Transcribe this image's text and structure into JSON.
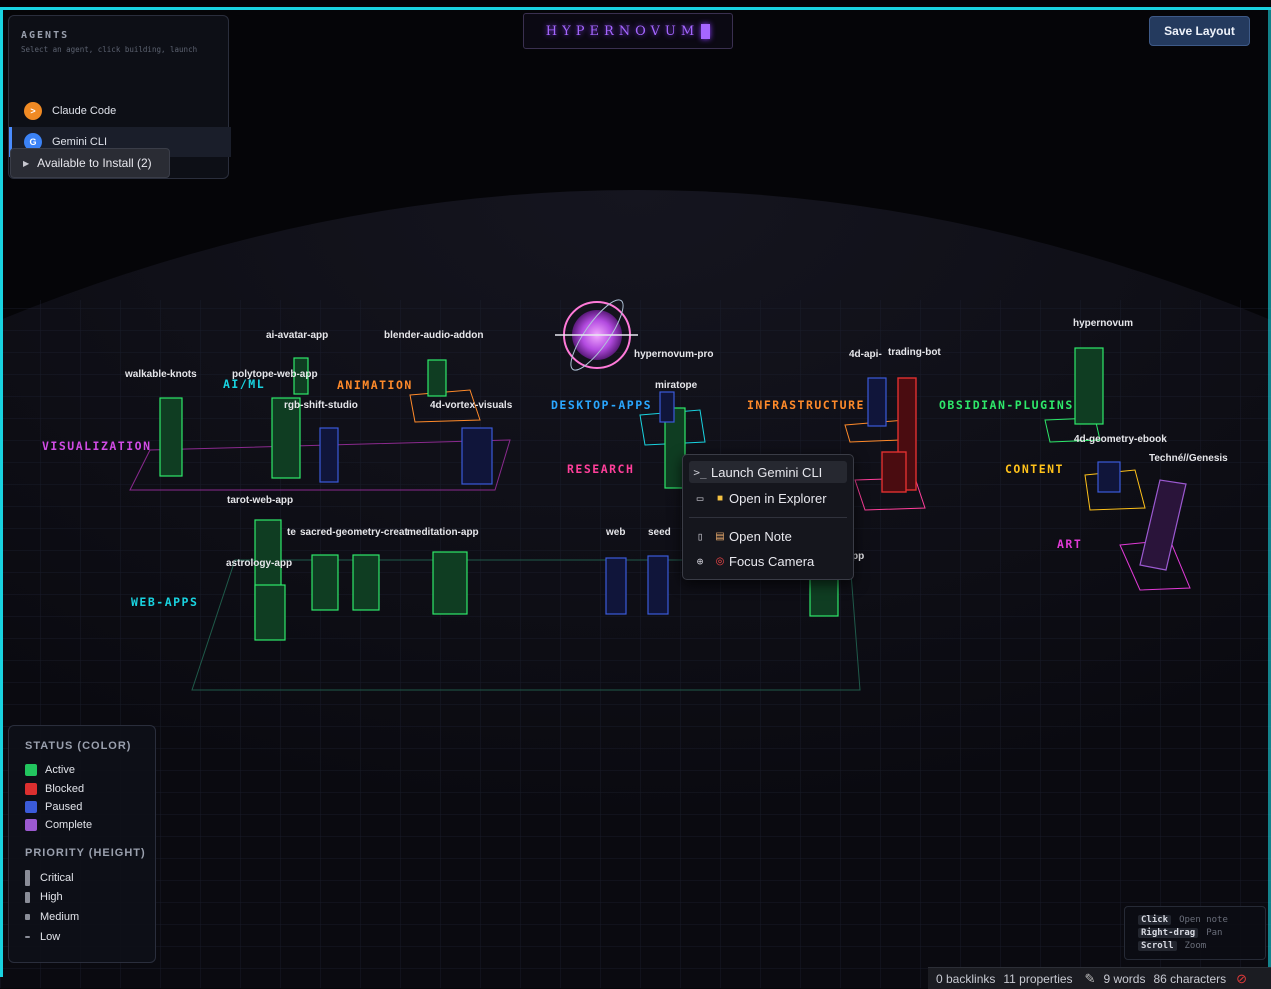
{
  "app": {
    "title": "HYPERNOVUM",
    "save_label": "Save Layout"
  },
  "agents": {
    "title": "AGENTS",
    "subtitle": "Select an agent, click building, launch",
    "items": [
      {
        "label": "Claude Code",
        "icon": ">",
        "color": "#f08a24"
      },
      {
        "label": "Gemini CLI",
        "icon": "G",
        "color": "#3b82f6",
        "selected": true
      }
    ],
    "install_label": "Available to Install (2)"
  },
  "districts": [
    {
      "label": "VISUALIZATION",
      "color": "#d14ce6"
    },
    {
      "label": "AI/ML",
      "color": "#19d3e0"
    },
    {
      "label": "ANIMATION",
      "color": "#ff8a2a"
    },
    {
      "label": "DESKTOP-APPS",
      "color": "#2aa7ff"
    },
    {
      "label": "INFRASTRUCTURE",
      "color": "#ff8a2a"
    },
    {
      "label": "OBSIDIAN-PLUGINS",
      "color": "#2ee86a"
    },
    {
      "label": "RESEARCH",
      "color": "#ff3f9a"
    },
    {
      "label": "CONTENT",
      "color": "#ffc21a"
    },
    {
      "label": "ART",
      "color": "#e03ad6"
    },
    {
      "label": "WEB-APPS",
      "color": "#19d3e0"
    }
  ],
  "projects": [
    "ai-avatar-app",
    "blender-audio-addon",
    "walkable-knots",
    "polytope-web-app",
    "rgb-shift-studio",
    "4d-vortex-visuals",
    "hypernovum-pro",
    "miratope",
    "4d-api-",
    "trading-bot",
    "hypernovum",
    "4d-geometry-ebook",
    "Techné//Genesis",
    "tarot-web-app",
    "te",
    "sacred-geometry-creat",
    "meditation-app",
    "astrology-app",
    "web",
    "seed",
    "pp"
  ],
  "context_menu": {
    "launch": "Launch Gemini CLI",
    "open_explorer": "Open in Explorer",
    "open_note": "Open Note",
    "focus_camera": "Focus Camera"
  },
  "legend": {
    "status_title": "STATUS (COLOR)",
    "status": [
      {
        "label": "Active",
        "color": "#22c55e"
      },
      {
        "label": "Blocked",
        "color": "#dc2f2f"
      },
      {
        "label": "Paused",
        "color": "#3b5bd9"
      },
      {
        "label": "Complete",
        "color": "#9b59d0"
      }
    ],
    "priority_title": "PRIORITY (HEIGHT)",
    "priority": [
      "Critical",
      "High",
      "Medium",
      "Low"
    ]
  },
  "help": [
    {
      "key": "Click",
      "action": "Open note"
    },
    {
      "key": "Right-drag",
      "action": "Pan"
    },
    {
      "key": "Scroll",
      "action": "Zoom"
    }
  ],
  "statusbar": {
    "backlinks": "0 backlinks",
    "properties": "11 properties",
    "words": "9 words",
    "characters": "86 characters"
  }
}
